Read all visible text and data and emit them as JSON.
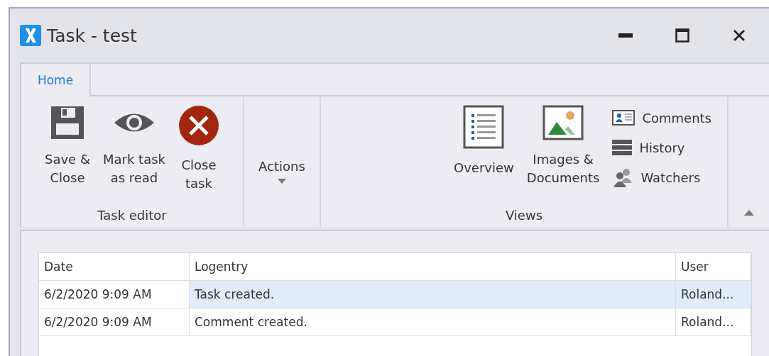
{
  "window": {
    "title": "Task - test"
  },
  "tabs": [
    {
      "label": "Home",
      "selected": true
    }
  ],
  "ribbon_groups": [
    {
      "label": "Task editor",
      "items": [
        {
          "kind": "large",
          "lines": [
            "Save &",
            "Close"
          ]
        },
        {
          "kind": "large",
          "lines": [
            "Mark task",
            "as read"
          ]
        },
        {
          "kind": "large",
          "lines": [
            "Close",
            "task"
          ]
        }
      ]
    },
    {
      "items": [
        {
          "kind": "dropdown",
          "lines": [
            "Actions"
          ]
        }
      ]
    },
    {
      "label": "Views",
      "items": [
        {
          "kind": "large",
          "lines": [
            "Overview"
          ]
        },
        {
          "kind": "large",
          "lines": [
            "Images &",
            "Documents"
          ]
        },
        {
          "kind": "stack",
          "entries": [
            "Comments",
            "History",
            "Watchers"
          ]
        }
      ]
    }
  ],
  "table": {
    "columns": [
      "Date",
      "Logentry",
      "User"
    ],
    "rows": [
      {
        "selected": true,
        "cells": [
          "6/2/2020 9:09 AM",
          "Task created.",
          "Roland..."
        ]
      },
      {
        "selected": false,
        "cells": [
          "6/2/2020 9:09 AM",
          "Comment created.",
          "Roland..."
        ]
      }
    ]
  }
}
